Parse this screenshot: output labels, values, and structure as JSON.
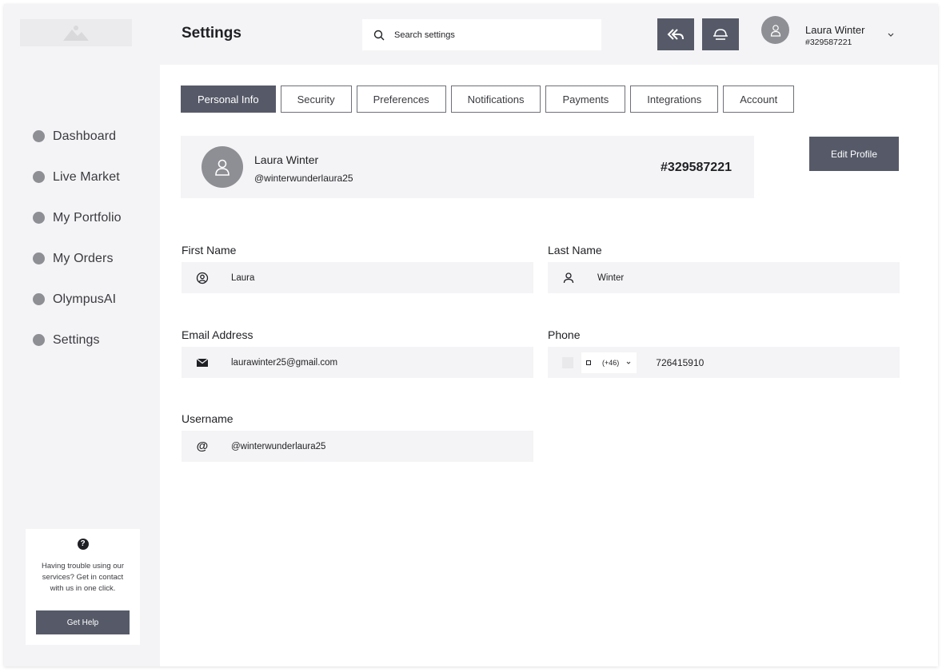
{
  "header": {
    "title": "Settings",
    "search_placeholder": "Search settings",
    "icons": [
      "reply-all-icon",
      "dome-icon"
    ],
    "user": {
      "name": "Laura Winter",
      "id": "#329587221"
    }
  },
  "sidebar": {
    "items": [
      {
        "label": "Dashboard"
      },
      {
        "label": "Live Market"
      },
      {
        "label": "My Portfolio"
      },
      {
        "label": "My Orders"
      },
      {
        "label": "OlympusAI"
      },
      {
        "label": "Settings"
      }
    ],
    "help": {
      "text": "Having trouble using our services? Get in contact with us in one click.",
      "button": "Get Help"
    }
  },
  "tabs": [
    {
      "label": "Personal Info",
      "active": true
    },
    {
      "label": "Security"
    },
    {
      "label": "Preferences"
    },
    {
      "label": "Notifications"
    },
    {
      "label": "Payments"
    },
    {
      "label": "Integrations"
    },
    {
      "label": "Account"
    }
  ],
  "profile": {
    "name": "Laura Winter",
    "handle": "@winterwunderlaura25",
    "id": "#329587221",
    "edit_label": "Edit Profile"
  },
  "form": {
    "first_name": {
      "label": "First Name",
      "value": "Laura"
    },
    "last_name": {
      "label": "Last Name",
      "value": "Winter"
    },
    "email": {
      "label": "Email Address",
      "value": "laurawinter25@gmail.com"
    },
    "phone": {
      "label": "Phone",
      "code": "(+46)",
      "value": "726415910"
    },
    "username": {
      "label": "Username",
      "value": "@winterwunderlaura25"
    }
  },
  "colors": {
    "accent": "#565a68",
    "background": "#f4f4f6",
    "panel": "#ffffff",
    "dot": "#8e8f94"
  }
}
